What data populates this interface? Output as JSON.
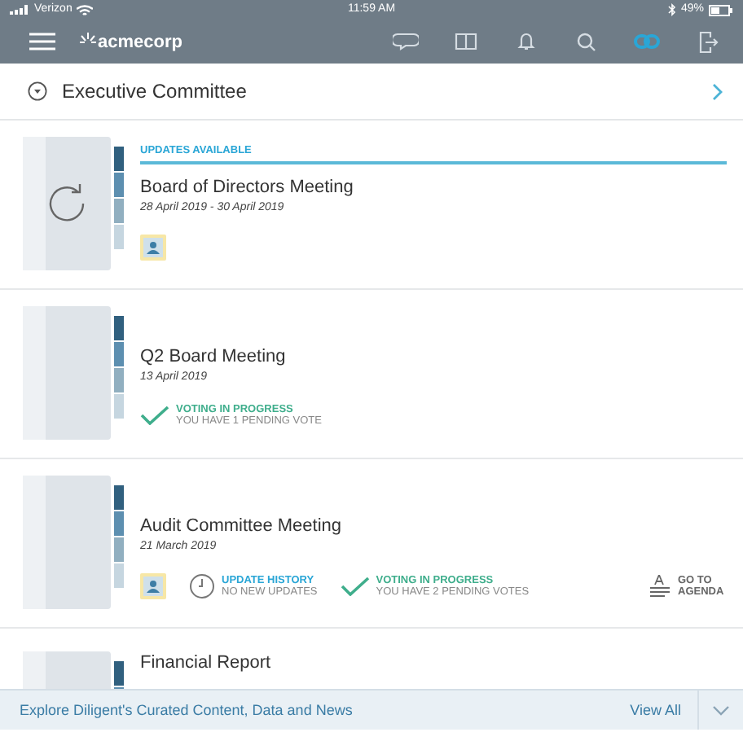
{
  "status_bar": {
    "carrier": "Verizon",
    "time": "11:59 AM",
    "battery": "49%"
  },
  "header": {
    "logo": "acmecorp",
    "tools": [
      {
        "kind": "chat",
        "selected": false
      },
      {
        "kind": "book",
        "selected": false
      },
      {
        "kind": "bell",
        "selected": false
      },
      {
        "kind": "search",
        "selected": false
      },
      {
        "kind": "link",
        "selected": true
      },
      {
        "kind": "exit",
        "selected": false
      }
    ]
  },
  "committee": {
    "title": "Executive Committee"
  },
  "meetings": [
    {
      "kind": "syncing",
      "banner": "UPDATES AVAILABLE",
      "title": "Board of Directors Meeting",
      "dates": "28 April 2019 - 30 April 2019",
      "items": [
        {
          "kind": "attendee"
        }
      ]
    },
    {
      "kind": "binder",
      "title": "Q2 Board Meeting",
      "dates": "13 April 2019",
      "items": [
        {
          "kind": "voting",
          "title": "VOTING IN PROGRESS",
          "subtitle": "YOU HAVE 1 PENDING VOTE"
        }
      ]
    },
    {
      "kind": "binder",
      "title": "Audit Committee Meeting",
      "dates": "21 March 2019",
      "items": [
        {
          "kind": "attendee"
        },
        {
          "kind": "history",
          "title": "UPDATE HISTORY",
          "subtitle": "NO NEW UPDATES"
        },
        {
          "kind": "voting",
          "title": "VOTING IN PROGRESS",
          "subtitle": "YOU HAVE 2 PENDING VOTES"
        },
        {
          "kind": "agenda",
          "label": "GO TO AGENDA"
        }
      ]
    },
    {
      "kind": "binder",
      "title": "Financial Report"
    }
  ],
  "footer": {
    "text": "Explore Diligent's Curated Content, Data and News",
    "link": "View All"
  }
}
